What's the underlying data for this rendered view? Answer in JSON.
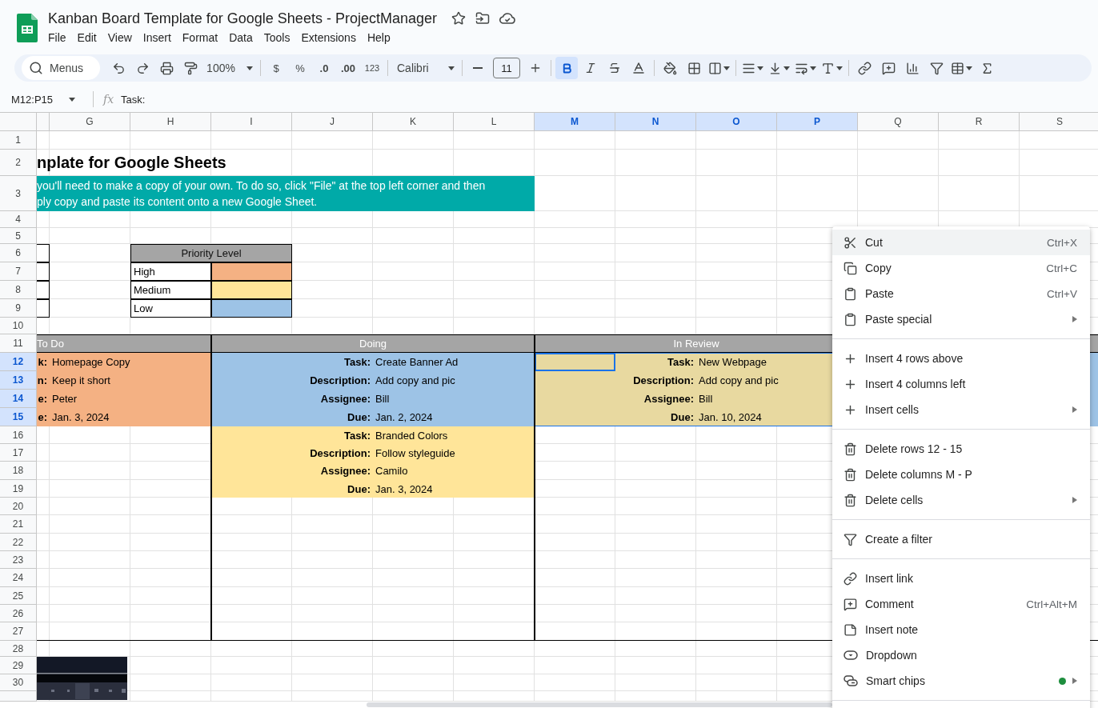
{
  "app": {
    "title": "Kanban Board Template for Google Sheets - ProjectManager",
    "menus": [
      "File",
      "Edit",
      "View",
      "Insert",
      "Format",
      "Data",
      "Tools",
      "Extensions",
      "Help"
    ]
  },
  "toolbar": {
    "search_placeholder": "Menus",
    "zoom": "100%",
    "currency": "$",
    "percent": "%",
    "decrease_decimals": ".0",
    "increase_decimals": ".00",
    "number_format": "123",
    "font": "Calibri",
    "font_size": "11",
    "bold": true,
    "italic": false,
    "strikethrough": false
  },
  "formula_bar": {
    "name_box": "M12:P15",
    "function_label": "fx",
    "formula": "Task:"
  },
  "columns": [
    {
      "label": "G",
      "selected": false
    },
    {
      "label": "H",
      "selected": false
    },
    {
      "label": "I",
      "selected": false
    },
    {
      "label": "J",
      "selected": false
    },
    {
      "label": "K",
      "selected": false
    },
    {
      "label": "L",
      "selected": false
    },
    {
      "label": "M",
      "selected": true
    },
    {
      "label": "N",
      "selected": true
    },
    {
      "label": "O",
      "selected": true
    },
    {
      "label": "P",
      "selected": true
    },
    {
      "label": "Q",
      "selected": false
    },
    {
      "label": "R",
      "selected": false
    },
    {
      "label": "S",
      "selected": false
    }
  ],
  "rows": [
    {
      "label": "1",
      "selected": false
    },
    {
      "label": "2",
      "selected": false
    },
    {
      "label": "3",
      "selected": false
    },
    {
      "label": "4",
      "selected": false
    },
    {
      "label": "5",
      "selected": false
    },
    {
      "label": "6",
      "selected": false
    },
    {
      "label": "7",
      "selected": false
    },
    {
      "label": "8",
      "selected": false
    },
    {
      "label": "9",
      "selected": false
    },
    {
      "label": "10",
      "selected": false
    },
    {
      "label": "11",
      "selected": false
    },
    {
      "label": "12",
      "selected": true
    },
    {
      "label": "13",
      "selected": true
    },
    {
      "label": "14",
      "selected": true
    },
    {
      "label": "15",
      "selected": true
    },
    {
      "label": "16",
      "selected": false
    },
    {
      "label": "17",
      "selected": false
    },
    {
      "label": "18",
      "selected": false
    },
    {
      "label": "19",
      "selected": false
    },
    {
      "label": "20",
      "selected": false
    },
    {
      "label": "21",
      "selected": false
    },
    {
      "label": "22",
      "selected": false
    },
    {
      "label": "23",
      "selected": false
    },
    {
      "label": "24",
      "selected": false
    },
    {
      "label": "25",
      "selected": false
    },
    {
      "label": "26",
      "selected": false
    },
    {
      "label": "27",
      "selected": false
    },
    {
      "label": "28",
      "selected": false
    },
    {
      "label": "29",
      "selected": false
    },
    {
      "label": "30",
      "selected": false
    }
  ],
  "sheet": {
    "heading": "nplate for Google Sheets",
    "notice": [
      "you'll need to make a copy of your own. To do so, click \"File\" at the top left corner and then",
      "ply copy and paste its content onto a new Google Sheet."
    ],
    "legend": {
      "title": "Priority Level",
      "levels": [
        {
          "label": "High",
          "color": "#f4b183"
        },
        {
          "label": "Medium",
          "color": "#ffe599"
        },
        {
          "label": "Low",
          "color": "#9dc3e6"
        }
      ]
    },
    "board": [
      {
        "title": "To Do",
        "cards": [
          {
            "color": "#f4b183",
            "fields": [
              {
                "label": "k:",
                "value": "Homepage Copy"
              },
              {
                "label": "n:",
                "value": "Keep it short"
              },
              {
                "label": "e:",
                "value": "Peter"
              },
              {
                "label": "e:",
                "value": "Jan. 3, 2024"
              }
            ]
          }
        ]
      },
      {
        "title": "Doing",
        "cards": [
          {
            "color": "#9dc3e6",
            "fields": [
              {
                "label": "Task:",
                "value": "Create Banner Ad"
              },
              {
                "label": "Description:",
                "value": "Add copy and pic"
              },
              {
                "label": "Assignee:",
                "value": "Bill"
              },
              {
                "label": "Due:",
                "value": "Jan. 2, 2024"
              }
            ]
          },
          {
            "color": "#ffe599",
            "fields": [
              {
                "label": "Task:",
                "value": "Branded Colors"
              },
              {
                "label": "Description:",
                "value": "Follow styleguide"
              },
              {
                "label": "Assignee:",
                "value": "Camilo"
              },
              {
                "label": "Due:",
                "value": "Jan. 3, 2024"
              }
            ]
          }
        ]
      },
      {
        "title": "In Review",
        "cards": [
          {
            "color": "#e8d9a0",
            "fields": [
              {
                "label": "Task:",
                "value": "New Webpage"
              },
              {
                "label": "Description:",
                "value": "Add copy and pic"
              },
              {
                "label": "Assignee:",
                "value": "Bill"
              },
              {
                "label": "Due:",
                "value": "Jan. 10, 2024"
              }
            ]
          }
        ]
      },
      {
        "cards": [
          {
            "color": "#9dc3e6"
          }
        ]
      }
    ]
  },
  "context_menu": {
    "groups": [
      [
        {
          "label": "Cut",
          "shortcut": "Ctrl+X",
          "submenu": false,
          "selected": true,
          "indicator": false
        },
        {
          "label": "Copy",
          "shortcut": "Ctrl+C",
          "submenu": false,
          "selected": false,
          "indicator": false
        },
        {
          "label": "Paste",
          "shortcut": "Ctrl+V",
          "submenu": false,
          "selected": false,
          "indicator": false
        },
        {
          "label": "Paste special",
          "submenu": true,
          "selected": false,
          "indicator": false
        }
      ],
      [
        {
          "label": "Insert 4 rows above",
          "submenu": false,
          "selected": false,
          "indicator": false
        },
        {
          "label": "Insert 4 columns left",
          "submenu": false,
          "selected": false,
          "indicator": false
        },
        {
          "label": "Insert cells",
          "submenu": true,
          "selected": false,
          "indicator": false
        }
      ],
      [
        {
          "label": "Delete rows 12 - 15",
          "submenu": false,
          "selected": false,
          "indicator": false
        },
        {
          "label": "Delete columns M - P",
          "submenu": false,
          "selected": false,
          "indicator": false
        },
        {
          "label": "Delete cells",
          "submenu": true,
          "selected": false,
          "indicator": false
        }
      ],
      [
        {
          "label": "Create a filter",
          "submenu": false,
          "selected": false,
          "indicator": false
        }
      ],
      [
        {
          "label": "Insert link",
          "submenu": false,
          "selected": false,
          "indicator": false
        },
        {
          "label": "Comment",
          "shortcut": "Ctrl+Alt+M",
          "submenu": false,
          "selected": false,
          "indicator": false
        },
        {
          "label": "Insert note",
          "submenu": false,
          "selected": false,
          "indicator": false
        },
        {
          "label": "Dropdown",
          "submenu": false,
          "selected": false,
          "indicator": false
        },
        {
          "label": "Smart chips",
          "submenu": true,
          "selected": false,
          "indicator": true
        }
      ]
    ]
  }
}
